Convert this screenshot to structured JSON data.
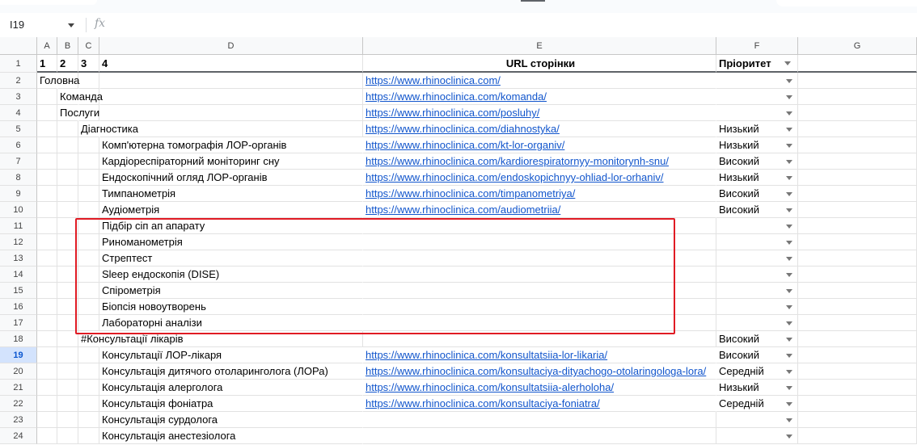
{
  "name_box": "I19",
  "fx_label": "fx",
  "columns": [
    "A",
    "B",
    "C",
    "D",
    "E",
    "F",
    "G"
  ],
  "header_row": {
    "num": "1",
    "a": "1",
    "b": "2",
    "c": "3",
    "d": "4",
    "e": "URL сторінки",
    "f": "Пріоритет"
  },
  "rows": [
    {
      "num": "2",
      "level": 1,
      "text": "Головна",
      "url": "https://www.rhinoclinica.com/",
      "priority": ""
    },
    {
      "num": "3",
      "level": 2,
      "text": "Команда",
      "url": "https://www.rhinoclinica.com/komanda/",
      "priority": ""
    },
    {
      "num": "4",
      "level": 2,
      "text": "Послуги",
      "url": "https://www.rhinoclinica.com/posluhy/",
      "priority": ""
    },
    {
      "num": "5",
      "level": 3,
      "text": "Діагностика",
      "url": "https://www.rhinoclinica.com/diahnostyka/",
      "priority": "Низький"
    },
    {
      "num": "6",
      "level": 4,
      "text": "Комп'ютерна томографія ЛОР-органів",
      "url": "https://www.rhinoclinica.com/kt-lor-organiv/",
      "priority": "Низький"
    },
    {
      "num": "7",
      "level": 4,
      "text": "Кардіореспіраторний моніторинг сну",
      "url": "https://www.rhinoclinica.com/kardiorespiratornyy-monitorynh-snu/",
      "priority": "Високий"
    },
    {
      "num": "8",
      "level": 4,
      "text": "Ендоскопічний огляд ЛОР-органів",
      "url": "https://www.rhinoclinica.com/endoskopichnyy-ohliad-lor-orhaniv/",
      "priority": "Низький"
    },
    {
      "num": "9",
      "level": 4,
      "text": "Тимпанометрія",
      "url": "https://www.rhinoclinica.com/timpanometriya/",
      "priority": "Високий"
    },
    {
      "num": "10",
      "level": 4,
      "text": "Аудіометрія",
      "url": "https://www.rhinoclinica.com/audiometriia/",
      "priority": "Високий"
    },
    {
      "num": "11",
      "level": 4,
      "text": "Підбір сіп ап апарату",
      "url": "",
      "priority": ""
    },
    {
      "num": "12",
      "level": 4,
      "text": "Риноманометрія",
      "url": "",
      "priority": ""
    },
    {
      "num": "13",
      "level": 4,
      "text": "Стрептест",
      "url": "",
      "priority": ""
    },
    {
      "num": "14",
      "level": 4,
      "text": "Sleep ендоскопія (DISE)",
      "url": "",
      "priority": ""
    },
    {
      "num": "15",
      "level": 4,
      "text": "Спірометрія",
      "url": "",
      "priority": ""
    },
    {
      "num": "16",
      "level": 4,
      "text": "Біопсія новоутворень",
      "url": "",
      "priority": ""
    },
    {
      "num": "17",
      "level": 4,
      "text": "Лабораторні аналізи",
      "url": "",
      "priority": ""
    },
    {
      "num": "18",
      "level": 3,
      "text": "#Консультації лікарів",
      "url": "",
      "priority": "Високий"
    },
    {
      "num": "19",
      "level": 4,
      "text": "Консультації ЛОР-лікаря",
      "url": "https://www.rhinoclinica.com/konsultatsiia-lor-likaria/",
      "priority": "Високий"
    },
    {
      "num": "20",
      "level": 4,
      "text": "Консультація дитячого отоларинголога (ЛОРа)",
      "url": "https://www.rhinoclinica.com/konsultaciya-dityachogo-otolaringologa-lora/",
      "priority": "Середній"
    },
    {
      "num": "21",
      "level": 4,
      "text": "Консультація алерголога",
      "url": "https://www.rhinoclinica.com/konsultatsiia-alerholoha/",
      "priority": "Низький"
    },
    {
      "num": "22",
      "level": 4,
      "text": "Консультація фоніатра",
      "url": "https://www.rhinoclinica.com/konsultaciya-foniatra/",
      "priority": "Середній"
    },
    {
      "num": "23",
      "level": 4,
      "text": "Консультація сурдолога",
      "url": "",
      "priority": ""
    },
    {
      "num": "24",
      "level": 4,
      "text": "Консультація анестезіолога",
      "url": "",
      "priority": ""
    }
  ],
  "selected_row": "19",
  "colors": {
    "link": "#1155cc",
    "highlight_box": "#e01b24",
    "selected_header": "#d3e3fd"
  }
}
